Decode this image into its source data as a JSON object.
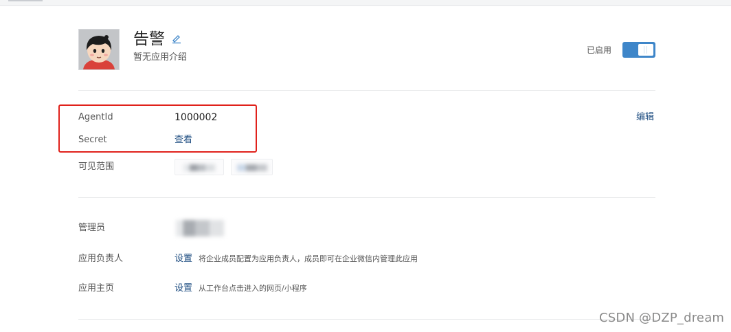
{
  "app": {
    "name": "告警",
    "description": "暂无应用介绍",
    "status_label": "已启用",
    "enabled": true,
    "accent_color": "#3e86c9",
    "edit_icon": "pencil-icon"
  },
  "details": {
    "agentid_label": "AgentId",
    "agentid_value": "1000002",
    "secret_label": "Secret",
    "secret_link": "查看",
    "edit_link": "编辑",
    "visibility_label": "可见范围",
    "visibility_chips": [
      "",
      ""
    ]
  },
  "admins": {
    "admin_label": "管理员",
    "owner_label": "应用负责人",
    "owner_link": "设置",
    "owner_hint": "将企业成员配置为应用负责人，成员即可在企业微信内管理此应用",
    "homepage_label": "应用主页",
    "homepage_link": "设置",
    "homepage_hint": "从工作台点击进入的网页/小程序"
  },
  "annotation": {
    "highlight_color": "#e0211b"
  },
  "watermark": "CSDN @DZP_dream"
}
